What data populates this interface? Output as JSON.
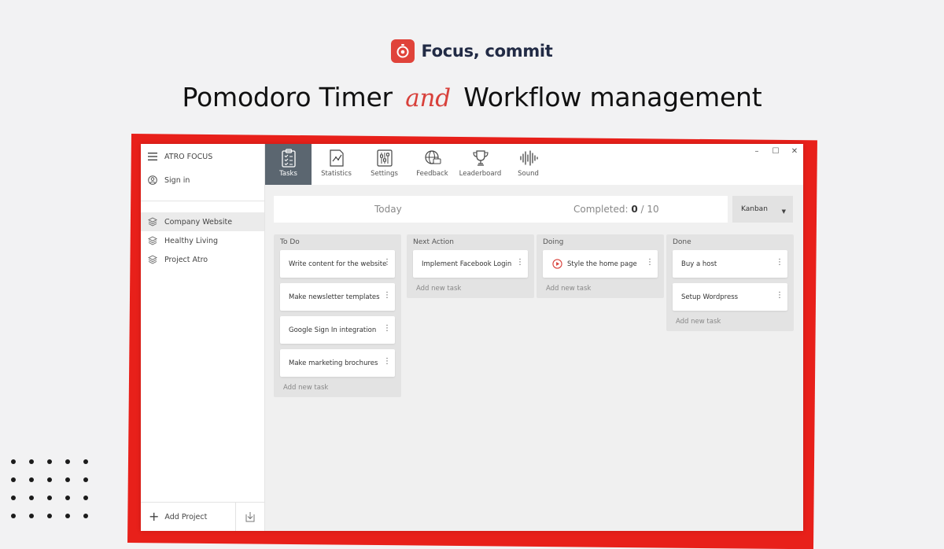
{
  "promo": {
    "brand_name": "Focus, commit",
    "headline_part1": "Pomodoro Timer",
    "headline_and": "and",
    "headline_part2": "Workflow management"
  },
  "colors": {
    "accent_red": "#e8201a",
    "brand_red": "#e0433a",
    "active_tab": "#5b6670"
  },
  "sidebar": {
    "app_title": "ATRO FOCUS",
    "menu_icon": "hamburger-icon",
    "sign_in": "Sign in",
    "sign_in_icon": "user-circle-icon",
    "projects": [
      {
        "label": "Company Website",
        "icon": "layers-icon",
        "selected": true
      },
      {
        "label": "Healthy Living",
        "icon": "layers-icon",
        "selected": false
      },
      {
        "label": "Project Atro",
        "icon": "layers-icon",
        "selected": false
      }
    ],
    "add_project": "Add Project",
    "export_icon": "download-icon"
  },
  "toolbar": {
    "tabs": [
      {
        "label": "Tasks",
        "icon": "clipboard-checklist-icon",
        "active": true
      },
      {
        "label": "Statistics",
        "icon": "chart-document-icon",
        "active": false
      },
      {
        "label": "Settings",
        "icon": "sliders-icon",
        "active": false
      },
      {
        "label": "Feedback",
        "icon": "globe-chat-icon",
        "active": false
      },
      {
        "label": "Leaderboard",
        "icon": "trophy-icon",
        "active": false
      },
      {
        "label": "Sound",
        "icon": "sound-wave-icon",
        "active": false
      }
    ],
    "window_controls": {
      "minimize": "–",
      "maximize": "☐",
      "close": "✕"
    }
  },
  "summary": {
    "day": "Today",
    "completed_label": "Completed:",
    "completed_count": "0",
    "completed_total": "/ 10",
    "view_mode": "Kanban"
  },
  "board": {
    "add_task_label": "Add new task",
    "columns": [
      {
        "title": "To Do",
        "cards": [
          "Write content for the website",
          "Make newsletter templates",
          "Google Sign In integration",
          "Make marketing brochures"
        ]
      },
      {
        "title": "Next Action",
        "cards": [
          "Implement Facebook Login"
        ]
      },
      {
        "title": "Doing",
        "cards": [
          "Style the home page"
        ]
      },
      {
        "title": "Done",
        "cards": [
          "Buy a host",
          "Setup Wordpress"
        ]
      }
    ]
  }
}
